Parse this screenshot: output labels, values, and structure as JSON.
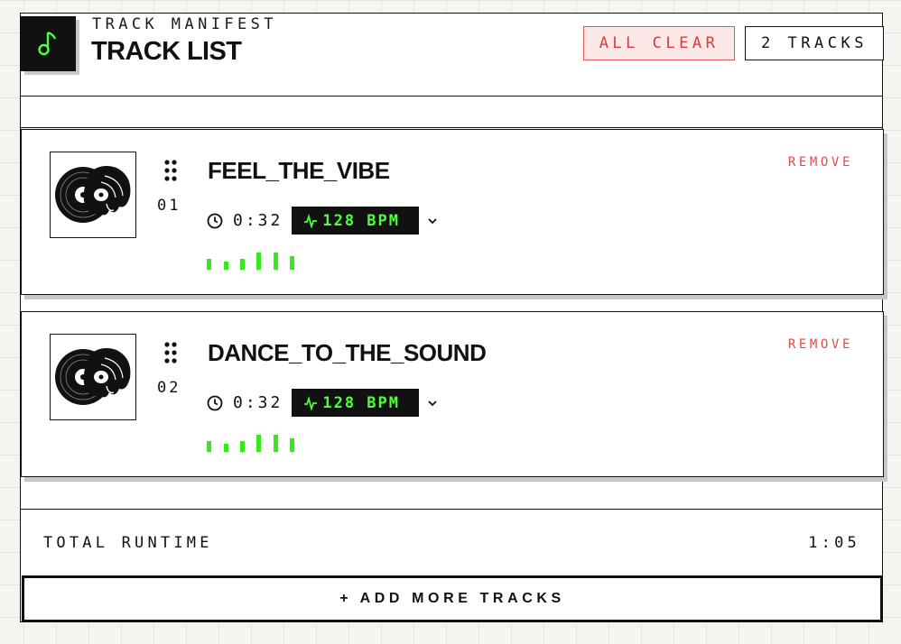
{
  "header": {
    "eyebrow": "TRACK MANIFEST",
    "title": "TRACK LIST",
    "clear_button": "ALL CLEAR",
    "track_count": "2 TRACKS",
    "logo_icon": "music-note-icon"
  },
  "tracks": [
    {
      "index": "01",
      "title": "FEEL_THE_VIBE",
      "duration": "0:32",
      "bpm": "128 BPM",
      "remove_label": "REMOVE",
      "cover_icon": "vinyl-record-icon"
    },
    {
      "index": "02",
      "title": "DANCE_TO_THE_SOUND",
      "duration": "0:32",
      "bpm": "128 BPM",
      "remove_label": "REMOVE",
      "cover_icon": "vinyl-record-icon"
    }
  ],
  "footer": {
    "runtime_label": "TOTAL RUNTIME",
    "runtime_value": "1:05",
    "add_button": "+ ADD MORE TRACKS"
  },
  "colors": {
    "accent_green": "#4cff3a",
    "wave_green": "#36e81e",
    "danger_red": "#e14b4b",
    "ink": "#111111"
  }
}
